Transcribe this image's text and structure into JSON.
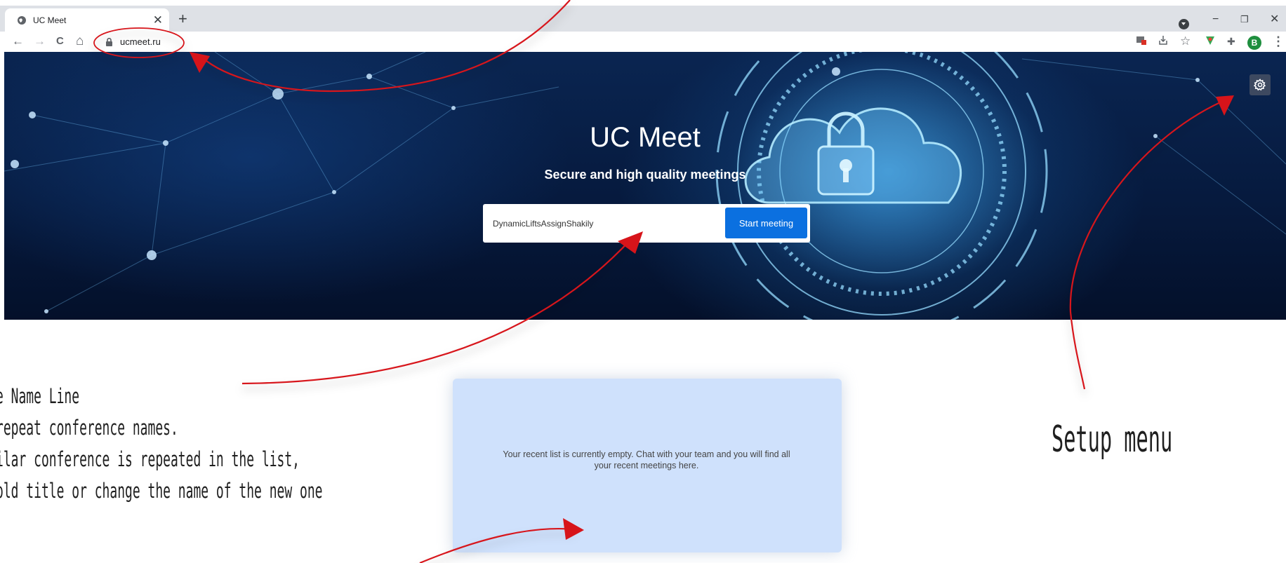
{
  "browser": {
    "tab_title": "UC Meet",
    "url": "ucmeet.ru",
    "profile_initial": "B",
    "glyphs": {
      "tab_close": "✕",
      "new_tab": "+",
      "back": "←",
      "forward": "→",
      "reload": "C",
      "home": "⌂",
      "star": "☆",
      "puzzle": "✚",
      "minimize": "−",
      "restore": "❐",
      "close": "✕",
      "menu": "⋮"
    }
  },
  "hero": {
    "title": "UC Meet",
    "subtitle": "Secure and high quality meetings",
    "room_name_value": "DynamicLiftsAssignShakily",
    "start_button_label": "Start meeting"
  },
  "recent": {
    "empty_message": "Your recent list is currently empty. Chat with your team and you will find all your recent meetings here."
  },
  "annotations": {
    "name_note_lines": [
      "e Name Line",
      "repeat conference names.",
      "ilar conference is repeated in the list,",
      "old title or change the name of the new one"
    ],
    "setup_label": "Setup menu"
  },
  "colors": {
    "accent": "#0b70e0",
    "panel": "#cfe1fc",
    "annotation_arrow": "#d7141a",
    "profile": "#1e8e3e"
  },
  "icons": [
    "globe-icon",
    "lock-icon",
    "gear-icon",
    "star-icon",
    "puzzle-icon",
    "download-icon",
    "extension-icon",
    "profile-menu-icon"
  ]
}
